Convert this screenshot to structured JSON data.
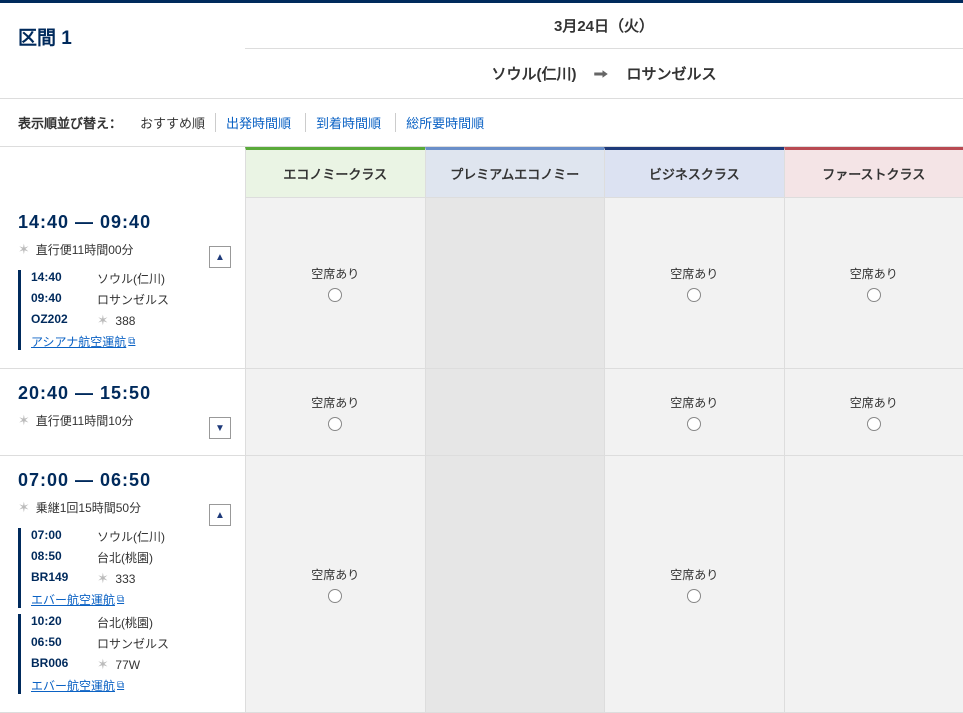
{
  "header": {
    "segment_label": "区間 1",
    "date": "3月24日（火）",
    "origin": "ソウル(仁川)",
    "destination": "ロサンゼルス"
  },
  "sort": {
    "label": "表示順並び替え：",
    "selected": "おすすめ順",
    "options": [
      "出発時間順",
      "到着時間順",
      "総所要時間順"
    ]
  },
  "classes": {
    "economy": "エコノミークラス",
    "premium": "プレミアムエコノミー",
    "business": "ビジネスクラス",
    "first": "ファーストクラス"
  },
  "availability_label": "空席あり",
  "flights": [
    {
      "dep": "14:40",
      "arr": "09:40",
      "meta": "直行便11時間00分",
      "expanded": true,
      "legs": [
        {
          "t1": "14:40",
          "v1": "ソウル(仁川)",
          "t2": "09:40",
          "v2": "ロサンゼルス",
          "code": "OZ202",
          "equip": "388",
          "operator": "アシアナ航空運航"
        }
      ],
      "avail": {
        "economy": true,
        "premium": false,
        "business": true,
        "first": true
      }
    },
    {
      "dep": "20:40",
      "arr": "15:50",
      "meta": "直行便11時間10分",
      "expanded": false,
      "legs": [],
      "avail": {
        "economy": true,
        "premium": false,
        "business": true,
        "first": true
      }
    },
    {
      "dep": "07:00",
      "arr": "06:50",
      "meta": "乗継1回15時間50分",
      "expanded": true,
      "legs": [
        {
          "t1": "07:00",
          "v1": "ソウル(仁川)",
          "t2": "08:50",
          "v2": "台北(桃園)",
          "code": "BR149",
          "equip": "333",
          "operator": "エバー航空運航"
        },
        {
          "t1": "10:20",
          "v1": "台北(桃園)",
          "t2": "06:50",
          "v2": "ロサンゼルス",
          "code": "BR006",
          "equip": "77W",
          "operator": "エバー航空運航"
        }
      ],
      "avail": {
        "economy": true,
        "premium": false,
        "business": true,
        "first": false
      }
    }
  ]
}
